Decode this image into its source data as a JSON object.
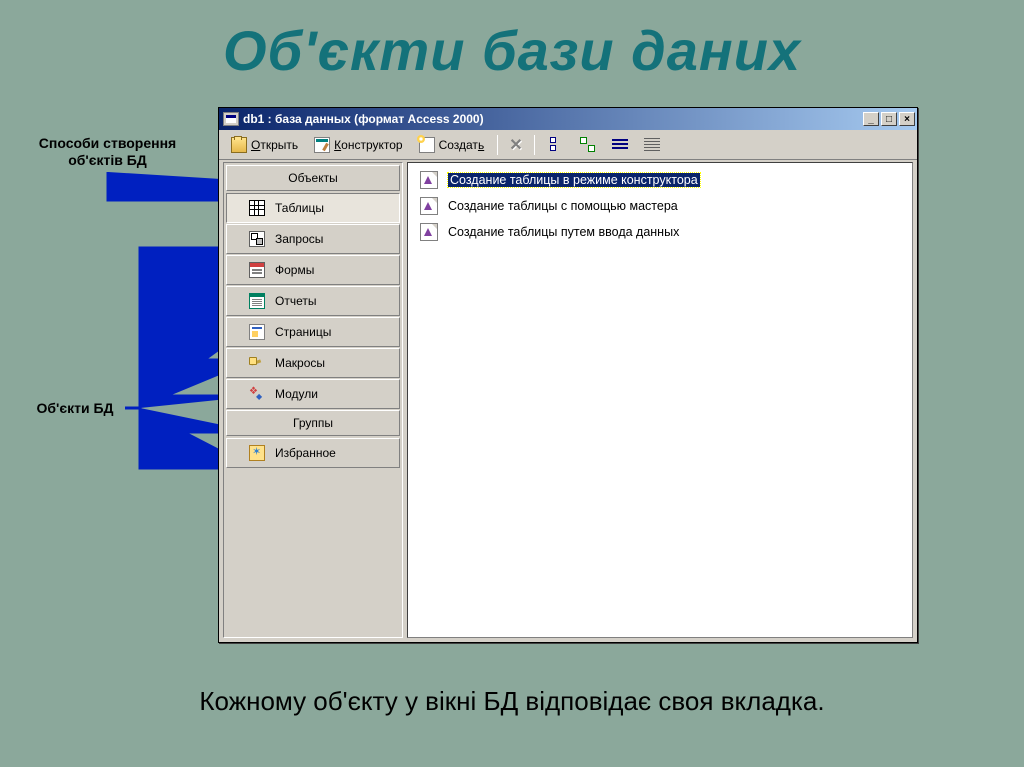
{
  "slide": {
    "title": "Об'єкти бази даних",
    "annotation_methods": "Способи створення об'єктів БД",
    "annotation_objects": "Об'єкти БД",
    "caption": "Кожному об'єкту у вікні БД відповідає своя вкладка."
  },
  "window": {
    "title": "db1 : база данных (формат Access 2000)"
  },
  "toolbar": {
    "open": "Открыть",
    "design": "Конструктор",
    "create": "Создать"
  },
  "sidebar": {
    "header_objects": "Объекты",
    "header_groups": "Группы",
    "items": [
      {
        "label": "Таблицы"
      },
      {
        "label": "Запросы"
      },
      {
        "label": "Формы"
      },
      {
        "label": "Отчеты"
      },
      {
        "label": "Страницы"
      },
      {
        "label": "Макросы"
      },
      {
        "label": "Модули"
      }
    ],
    "favorites": "Избранное"
  },
  "list": {
    "items": [
      {
        "label": "Создание таблицы в режиме конструктора"
      },
      {
        "label": "Создание таблицы с помощью мастера"
      },
      {
        "label": "Создание таблицы путем ввода данных"
      }
    ]
  }
}
